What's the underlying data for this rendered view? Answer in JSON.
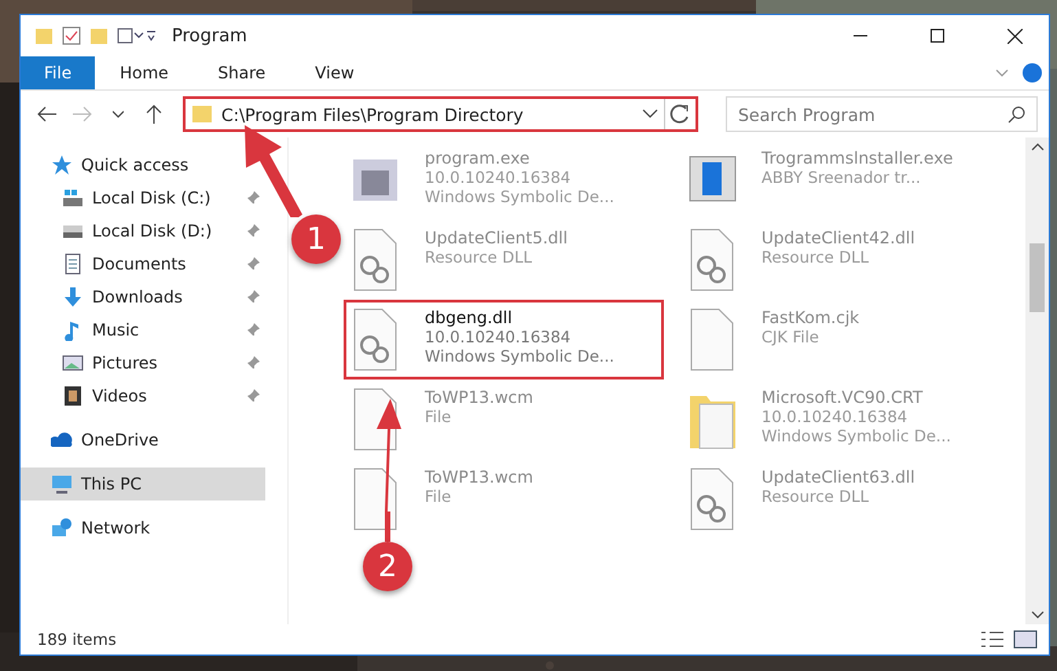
{
  "window": {
    "title": "Program"
  },
  "ribbon_tabs": [
    {
      "label": "File",
      "kind": "file"
    },
    {
      "label": "Home",
      "kind": "tab"
    },
    {
      "label": "Share",
      "kind": "tab"
    },
    {
      "label": "View",
      "kind": "tab"
    }
  ],
  "address_bar": {
    "path": "C:\\Program Files\\Program Directory",
    "highlighted": true
  },
  "search": {
    "placeholder": "Search Program"
  },
  "navigation": [
    {
      "label": "Quick access",
      "kind": "star",
      "selected": false,
      "children": [
        {
          "label": "Local Disk (C:)",
          "kind": "windows-drive",
          "selected": false,
          "pinned": true
        },
        {
          "label": "Local Disk (D:)",
          "kind": "drive",
          "selected": false,
          "pinned": true
        },
        {
          "label": "Documents",
          "kind": "documents",
          "selected": false,
          "pinned": true
        },
        {
          "label": "Downloads",
          "kind": "downloads",
          "selected": false,
          "pinned": true
        },
        {
          "label": "Music",
          "kind": "music",
          "selected": false,
          "pinned": true
        },
        {
          "label": "Pictures",
          "kind": "pictures",
          "selected": false,
          "pinned": true
        },
        {
          "label": "Videos",
          "kind": "videos",
          "selected": false,
          "pinned": true
        }
      ]
    },
    {
      "label": "OneDrive",
      "kind": "cloud",
      "selected": false
    },
    {
      "label": "This PC",
      "kind": "pc",
      "selected": true
    },
    {
      "label": "Network",
      "kind": "network",
      "selected": false
    }
  ],
  "files": [
    {
      "name": "program.exe",
      "details": [
        "10.0.10240.16384",
        "Windows Symbolic De..."
      ],
      "kind": "exe",
      "blurred": true,
      "highlighted": false
    },
    {
      "name": "Trogrammslnstaller.exe",
      "details": [
        "ABBY Sreenador tr..."
      ],
      "kind": "installer",
      "blurred": true,
      "highlighted": false
    },
    {
      "name": "UpdateClient5.dll",
      "details": [
        "Resource DLL"
      ],
      "kind": "dll",
      "blurred": true,
      "highlighted": false
    },
    {
      "name": "UpdateClient42.dll",
      "details": [
        "Resource DLL"
      ],
      "kind": "dll",
      "blurred": true,
      "highlighted": false
    },
    {
      "name": "dbgeng.dll",
      "details": [
        "10.0.10240.16384",
        "Windows Symbolic De..."
      ],
      "kind": "dll",
      "blurred": false,
      "highlighted": true
    },
    {
      "name": "FastKom.cjk",
      "details": [
        "CJK File"
      ],
      "kind": "file",
      "blurred": true,
      "highlighted": false
    },
    {
      "name": "ToWP13.wcm",
      "details": [
        "File"
      ],
      "kind": "file",
      "blurred": true,
      "highlighted": false
    },
    {
      "name": "Microsoft.VC90.CRT",
      "details": [
        "10.0.10240.16384",
        "Windows Symbolic De..."
      ],
      "kind": "folder",
      "blurred": true,
      "highlighted": false
    },
    {
      "name": "ToWP13.wcm",
      "details": [
        "File"
      ],
      "kind": "file",
      "blurred": true,
      "highlighted": false
    },
    {
      "name": "UpdateClient63.dll",
      "details": [
        "Resource DLL"
      ],
      "kind": "dll",
      "blurred": true,
      "highlighted": false
    }
  ],
  "status_bar": {
    "count": "189 items"
  },
  "callouts": [
    {
      "number": "1"
    },
    {
      "number": "2"
    }
  ]
}
